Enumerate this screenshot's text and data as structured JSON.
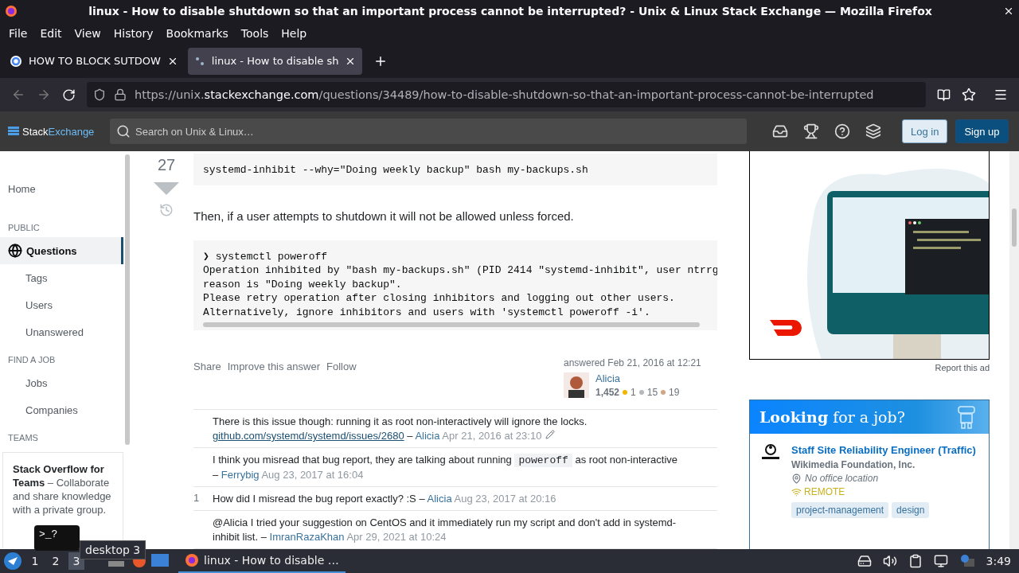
{
  "window": {
    "title": "linux - How to disable shutdown so that an important process cannot be interrupted? - Unix & Linux Stack Exchange — Mozilla Firefox"
  },
  "menu": [
    "File",
    "Edit",
    "View",
    "History",
    "Bookmarks",
    "Tools",
    "Help"
  ],
  "tabs": [
    {
      "label": "HOW TO BLOCK SUTDOW",
      "selected": false
    },
    {
      "label": "linux - How to disable sh",
      "selected": true
    }
  ],
  "url": {
    "scheme": "https://unix.",
    "domain": "stackexchange.com",
    "path": "/questions/34489/how-to-disable-shutdown-so-that-an-important-process-cannot-be-interrupted"
  },
  "site_header": {
    "logo_first": "Stack",
    "logo_second": "Exchange",
    "search_placeholder": "Search on Unix & Linux…",
    "login": "Log in",
    "signup": "Sign up"
  },
  "sidebar": {
    "items": [
      {
        "kind": "top",
        "label": "Home",
        "selected": false
      },
      {
        "kind": "heading",
        "label": "PUBLIC"
      },
      {
        "kind": "primary",
        "label": "Questions",
        "selected": true
      },
      {
        "kind": "sub",
        "label": "Tags",
        "selected": false
      },
      {
        "kind": "sub",
        "label": "Users",
        "selected": false
      },
      {
        "kind": "sub",
        "label": "Unanswered",
        "selected": false
      },
      {
        "kind": "heading",
        "label": "FIND A JOB"
      },
      {
        "kind": "sub",
        "label": "Jobs",
        "selected": false
      },
      {
        "kind": "sub",
        "label": "Companies",
        "selected": false
      },
      {
        "kind": "heading",
        "label": "TEAMS"
      }
    ],
    "teams_card": "**Stack Overflow for Teams** – Collaborate and share knowledge with a private group."
  },
  "answer": {
    "votes": "27",
    "code_first": "systemd-inhibit --why=\"Doing weekly backup\" bash my-backups.sh",
    "paragraph": "Then, if a user attempts to shutdown it will not be allowed unless forced.",
    "code_second": [
      "❯ systemctl poweroff",
      "Operation inhibited by \"bash my-backups.sh\" (PID 2414 \"systemd-inhibit\", user ntrrg",
      "reason is \"Doing weekly backup\".",
      "Please retry operation after closing inhibitors and logging out other users.",
      "Alternatively, ignore inhibitors and users with 'systemctl poweroff -i'."
    ],
    "actions": [
      "Share",
      "Improve this answer",
      "Follow"
    ],
    "signature": {
      "answered": "answered Feb 21, 2016 at 12:21",
      "user": "Alicia",
      "reputation": "1,452",
      "badges": [
        {
          "count": "1",
          "color": "#f1b600"
        },
        {
          "count": "15",
          "color": "#b4b8bc"
        },
        {
          "count": "19",
          "color": "#d1a684"
        }
      ]
    }
  },
  "comments": [
    {
      "segments": [
        {
          "kind": "text",
          "text": "There is this issue though: running it as root non-interactively will ignore the locks."
        },
        {
          "kind": "link",
          "text": "github.com/systemd/systemd/issues/2680"
        }
      ],
      "separator": "–",
      "author": "Alicia",
      "date": "Apr 21, 2016 at 23:10",
      "edited": true
    },
    {
      "segments": [
        {
          "kind": "text",
          "text": "I think you misread that bug report, they are talking about running"
        },
        {
          "kind": "code",
          "text": "poweroff"
        },
        {
          "kind": "text",
          "text": "as root non-interactive"
        }
      ],
      "separator": "–",
      "author": "Ferrybig",
      "date": "Aug 23, 2017 at 16:04",
      "edited": false
    },
    {
      "score": "1",
      "segments": [
        {
          "kind": "text",
          "text": "How did I misread the bug report exactly? :S"
        }
      ],
      "separator": "–",
      "author": "Alicia",
      "date": "Aug 23, 2017 at 20:16",
      "edited": false
    },
    {
      "segments": [
        {
          "kind": "text",
          "text": "@Alicia I tried your suggestion on CentOS and it immediately run my script and don't add in systemd-inhibit list."
        }
      ],
      "separator": "–",
      "author": "ImranRazaKhan",
      "date": "Apr 29, 2021 at 10:24",
      "edited": false
    }
  ],
  "ad": {
    "kind": "picture",
    "report": "Report this ad"
  },
  "jobs": {
    "heading": "**Looking** for a job?",
    "items": [
      {
        "title": "Staff Site Reliability Engineer (Traffic)",
        "company": "Wikimedia Foundation, Inc.",
        "location": "No office location",
        "remote": "REMOTE",
        "tags": [
          "project-management",
          "design"
        ]
      }
    ]
  },
  "taskbar": {
    "workspaces": [
      {
        "label": "1",
        "selected": false
      },
      {
        "label": "2",
        "selected": false
      },
      {
        "label": "3",
        "selected": true
      }
    ],
    "tooltip": "desktop 3",
    "preview": ">_?",
    "task": "linux - How to disable …",
    "clock": "3:49"
  }
}
